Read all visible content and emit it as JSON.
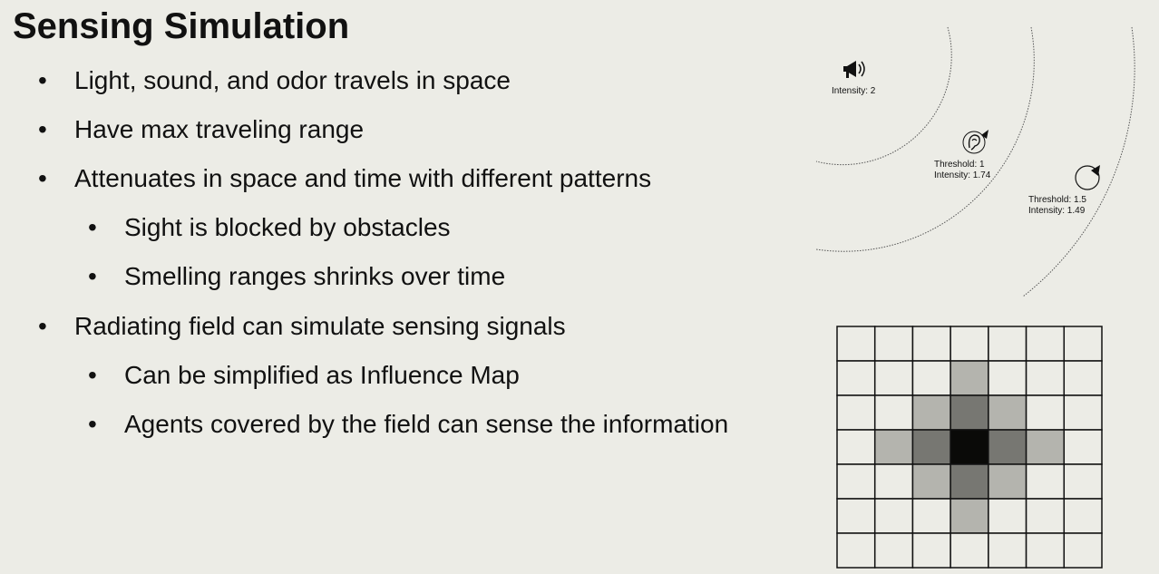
{
  "slide": {
    "title": "Sensing Simulation",
    "bullet_glyph": "•",
    "bullets": [
      {
        "text": "Light, sound, and odor travels in space",
        "level": 1
      },
      {
        "text": "Have max traveling range",
        "level": 1
      },
      {
        "text": "Attenuates in space and time with different patterns",
        "level": 1
      },
      {
        "text": "Sight is blocked by obstacles",
        "level": 2
      },
      {
        "text": "Smelling ranges shrinks over time",
        "level": 2
      },
      {
        "text": "Radiating field can simulate sensing signals",
        "level": 1
      },
      {
        "text": "Can be simplified as Influence Map",
        "level": 2
      },
      {
        "text": "Agents covered by the field can sense the information",
        "level": 2
      }
    ]
  },
  "diagram": {
    "source": {
      "icon": "megaphone-icon",
      "intensity_label": "Intensity: 2"
    },
    "listener_ear": {
      "icon": "ear-icon",
      "threshold_label": "Threshold: 1",
      "intensity_label": "Intensity: 1.74"
    },
    "listener_circle": {
      "icon": "circle-agent-icon",
      "threshold_label": "Threshold: 1.5",
      "intensity_label": "Intensity: 1.49"
    }
  },
  "influence_map": {
    "rows": 7,
    "cols": 7,
    "colors": {
      "0": "#ecece6",
      "1": "#b4b4ae",
      "2": "#777772",
      "3": "#0a0a08",
      "line": "#111111"
    },
    "levels": [
      [
        0,
        0,
        0,
        0,
        0,
        0,
        0
      ],
      [
        0,
        0,
        0,
        1,
        0,
        0,
        0
      ],
      [
        0,
        0,
        1,
        2,
        1,
        0,
        0
      ],
      [
        0,
        1,
        2,
        3,
        2,
        1,
        0
      ],
      [
        0,
        0,
        1,
        2,
        1,
        0,
        0
      ],
      [
        0,
        0,
        0,
        1,
        0,
        0,
        0
      ],
      [
        0,
        0,
        0,
        0,
        0,
        0,
        0
      ]
    ]
  }
}
